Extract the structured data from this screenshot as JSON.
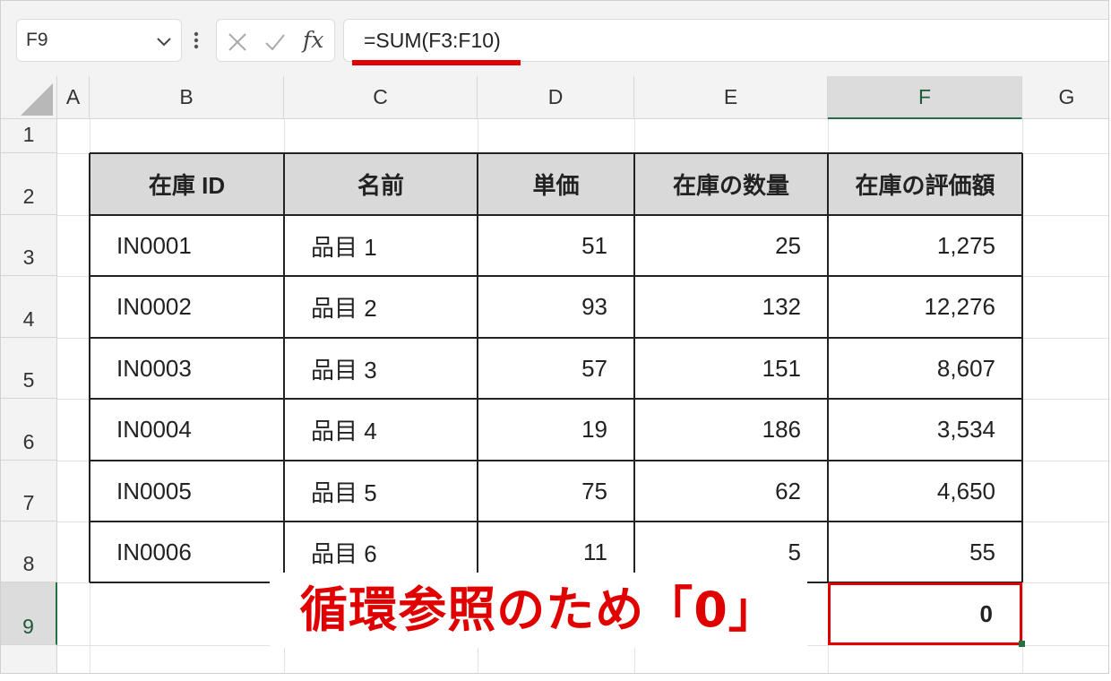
{
  "name_box": {
    "value": "F9"
  },
  "formula_bar": {
    "fx_label": "fx",
    "formula": "=SUM(F3:F10)"
  },
  "columns": [
    "A",
    "B",
    "C",
    "D",
    "E",
    "F",
    "G"
  ],
  "rows": [
    "1",
    "2",
    "3",
    "4",
    "5",
    "6",
    "7",
    "8",
    "9"
  ],
  "selected": {
    "column": "F",
    "row": "9"
  },
  "table": {
    "headers": [
      "在庫 ID",
      "名前",
      "単価",
      "在庫の数量",
      "在庫の評価額"
    ],
    "rows": [
      [
        "IN0001",
        "品目 1",
        "51",
        "25",
        "1,275"
      ],
      [
        "IN0002",
        "品目 2",
        "93",
        "132",
        "12,276"
      ],
      [
        "IN0003",
        "品目 3",
        "57",
        "151",
        "8,607"
      ],
      [
        "IN0004",
        "品目 4",
        "19",
        "186",
        "3,534"
      ],
      [
        "IN0005",
        "品目 5",
        "75",
        "62",
        "4,650"
      ],
      [
        "IN0006",
        "品目 6",
        "11",
        "5",
        "55"
      ]
    ]
  },
  "total_cell": {
    "value": "0"
  },
  "annotation": {
    "text": "循環参照のため「0」",
    "color": "#e00000"
  },
  "colors": {
    "accent": "#e00000",
    "selection": "#217346",
    "header_fill": "#d9d9d9"
  }
}
